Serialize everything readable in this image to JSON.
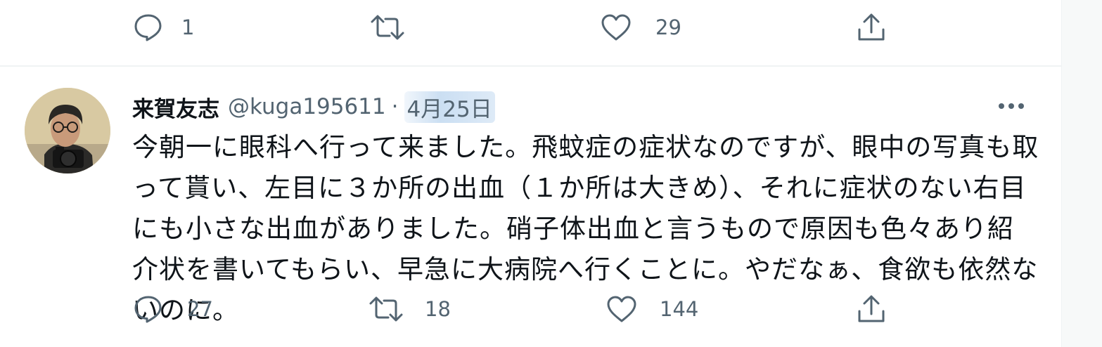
{
  "previous_tweet": {
    "actions": {
      "reply_count": "1",
      "retweet_count": "",
      "like_count": "29"
    }
  },
  "tweet": {
    "author": {
      "display_name": "来賀友志",
      "handle": "@kuga195611"
    },
    "separator": "·",
    "date": "4月25日",
    "text": "今朝一に眼科へ行って来ました。飛蚊症の症状なのですが、眼中の写真も取って貰い、左目に３か所の出血（１か所は大きめ）、それに症状のない右目にも小さな出血がありました。硝子体出血と言うもので原因も色々あり紹介状を書いてもらい、早急に大病院へ行くことに。やだなぁ、食欲も依然ないのに。",
    "actions": {
      "reply_count": "27",
      "retweet_count": "18",
      "like_count": "144"
    }
  },
  "icons": {
    "reply": "reply-icon",
    "retweet": "retweet-icon",
    "like": "heart-icon",
    "share": "share-icon",
    "more": "more-dots-icon"
  },
  "colors": {
    "text_primary": "#0f1419",
    "text_secondary": "#536471",
    "divider": "#eff3f4",
    "date_highlight": "#a0c4e8"
  }
}
